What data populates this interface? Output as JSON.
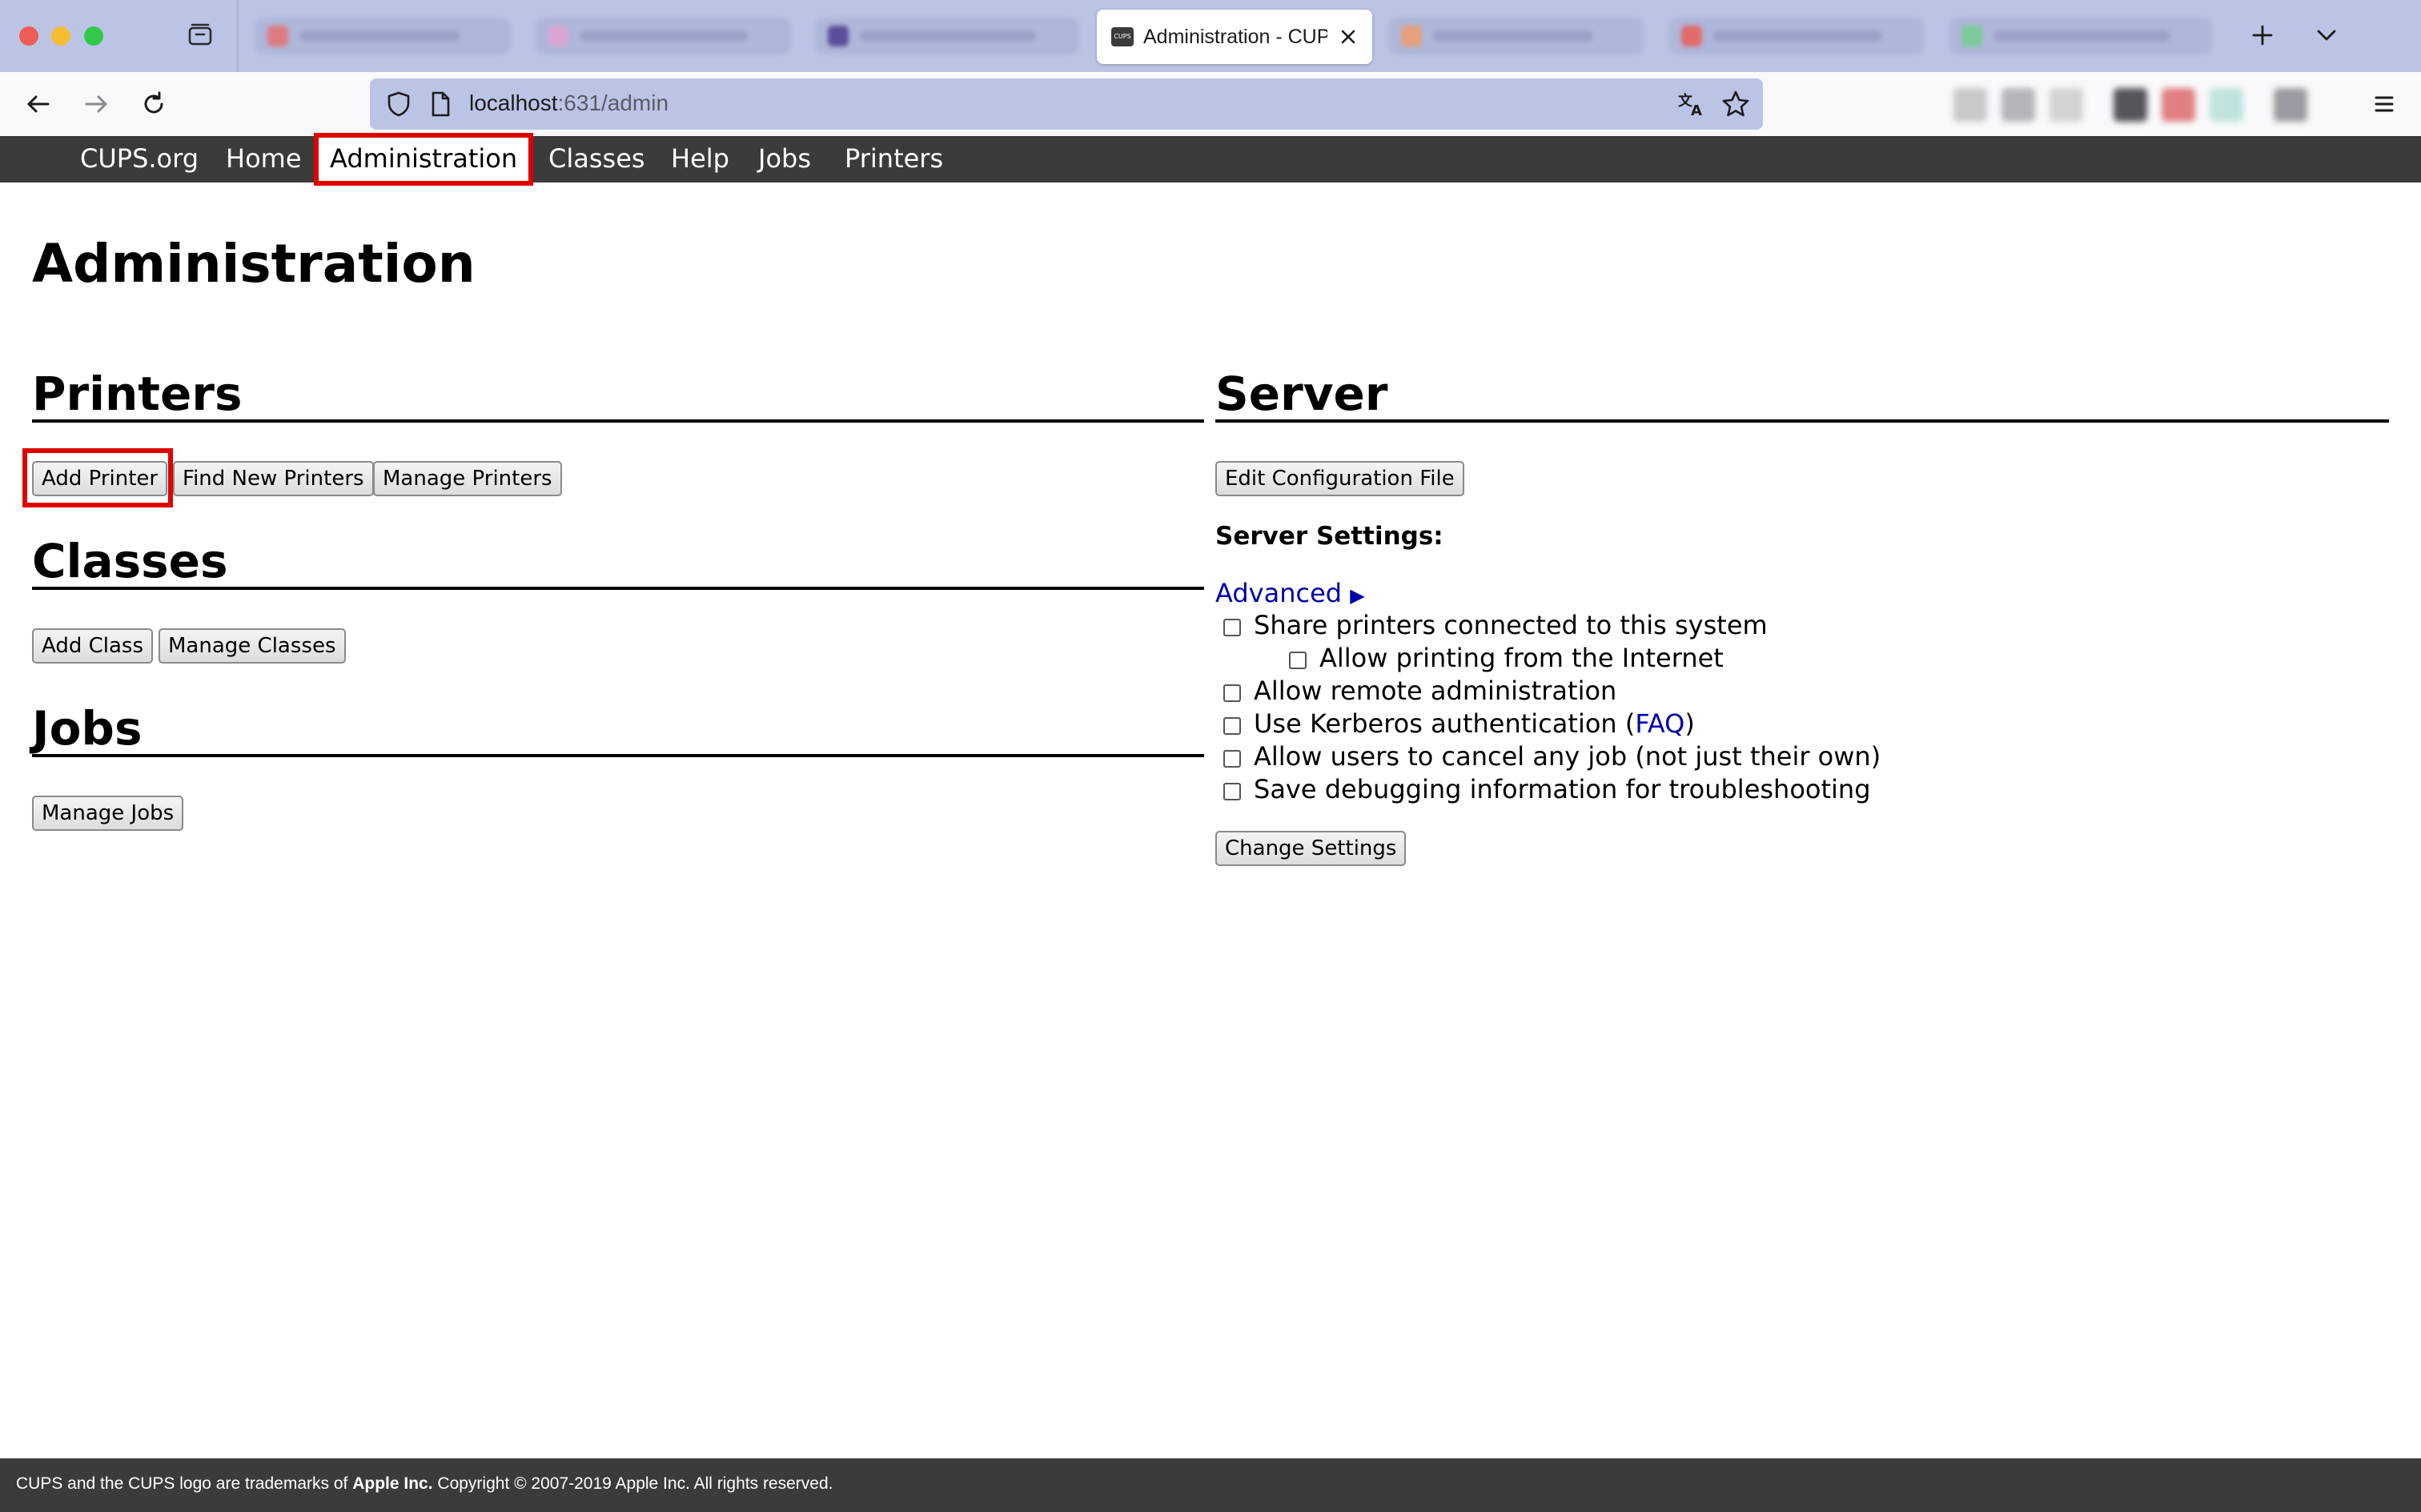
{
  "browser": {
    "active_tab": {
      "title": "Administration - CUPS",
      "favicon_label": "CUPS"
    },
    "url": {
      "host": "localhost",
      "path": ":631/admin"
    }
  },
  "cups": {
    "nav": [
      "CUPS.org",
      "Home",
      "Administration",
      "Classes",
      "Help",
      "Jobs",
      "Printers"
    ],
    "title": "Administration",
    "printers": {
      "heading": "Printers",
      "buttons": [
        "Add Printer",
        "Find New Printers",
        "Manage Printers"
      ]
    },
    "classes": {
      "heading": "Classes",
      "buttons": [
        "Add Class",
        "Manage Classes"
      ]
    },
    "jobs": {
      "heading": "Jobs",
      "buttons": [
        "Manage Jobs"
      ]
    },
    "server": {
      "heading": "Server",
      "edit_config_button": "Edit Configuration File",
      "settings_label": "Server Settings:",
      "advanced_link": "Advanced",
      "advanced_arrow": "▶",
      "options": [
        {
          "label": "Share printers connected to this system",
          "checked": false
        },
        {
          "label": "Allow printing from the Internet",
          "checked": false
        },
        {
          "label": "Allow remote administration",
          "checked": false
        },
        {
          "label": "Use Kerberos authentication (",
          "link": "FAQ",
          "suffix": ")",
          "checked": false
        },
        {
          "label": "Allow users to cancel any job (not just their own)",
          "checked": false
        },
        {
          "label": "Save debugging information for troubleshooting",
          "checked": false
        }
      ],
      "change_settings_button": "Change Settings"
    },
    "footer": {
      "prefix": "CUPS and the CUPS logo are trademarks of ",
      "brand": "Apple Inc.",
      "suffix": " Copyright © 2007-2019 Apple Inc. All rights reserved."
    }
  },
  "colors": {
    "highlight_annotation": "#e00000",
    "header_bg": "#3b3b3b",
    "link": "#0000aa",
    "tabbar_bg": "#bcc4e6"
  },
  "icons": [
    "tab-list-icon",
    "close-icon",
    "plus-icon",
    "chevron-down-icon",
    "back-arrow-icon",
    "forward-arrow-icon",
    "reload-icon",
    "shield-icon",
    "page-icon",
    "translate-icon",
    "star-icon",
    "hamburger-menu-icon"
  ]
}
